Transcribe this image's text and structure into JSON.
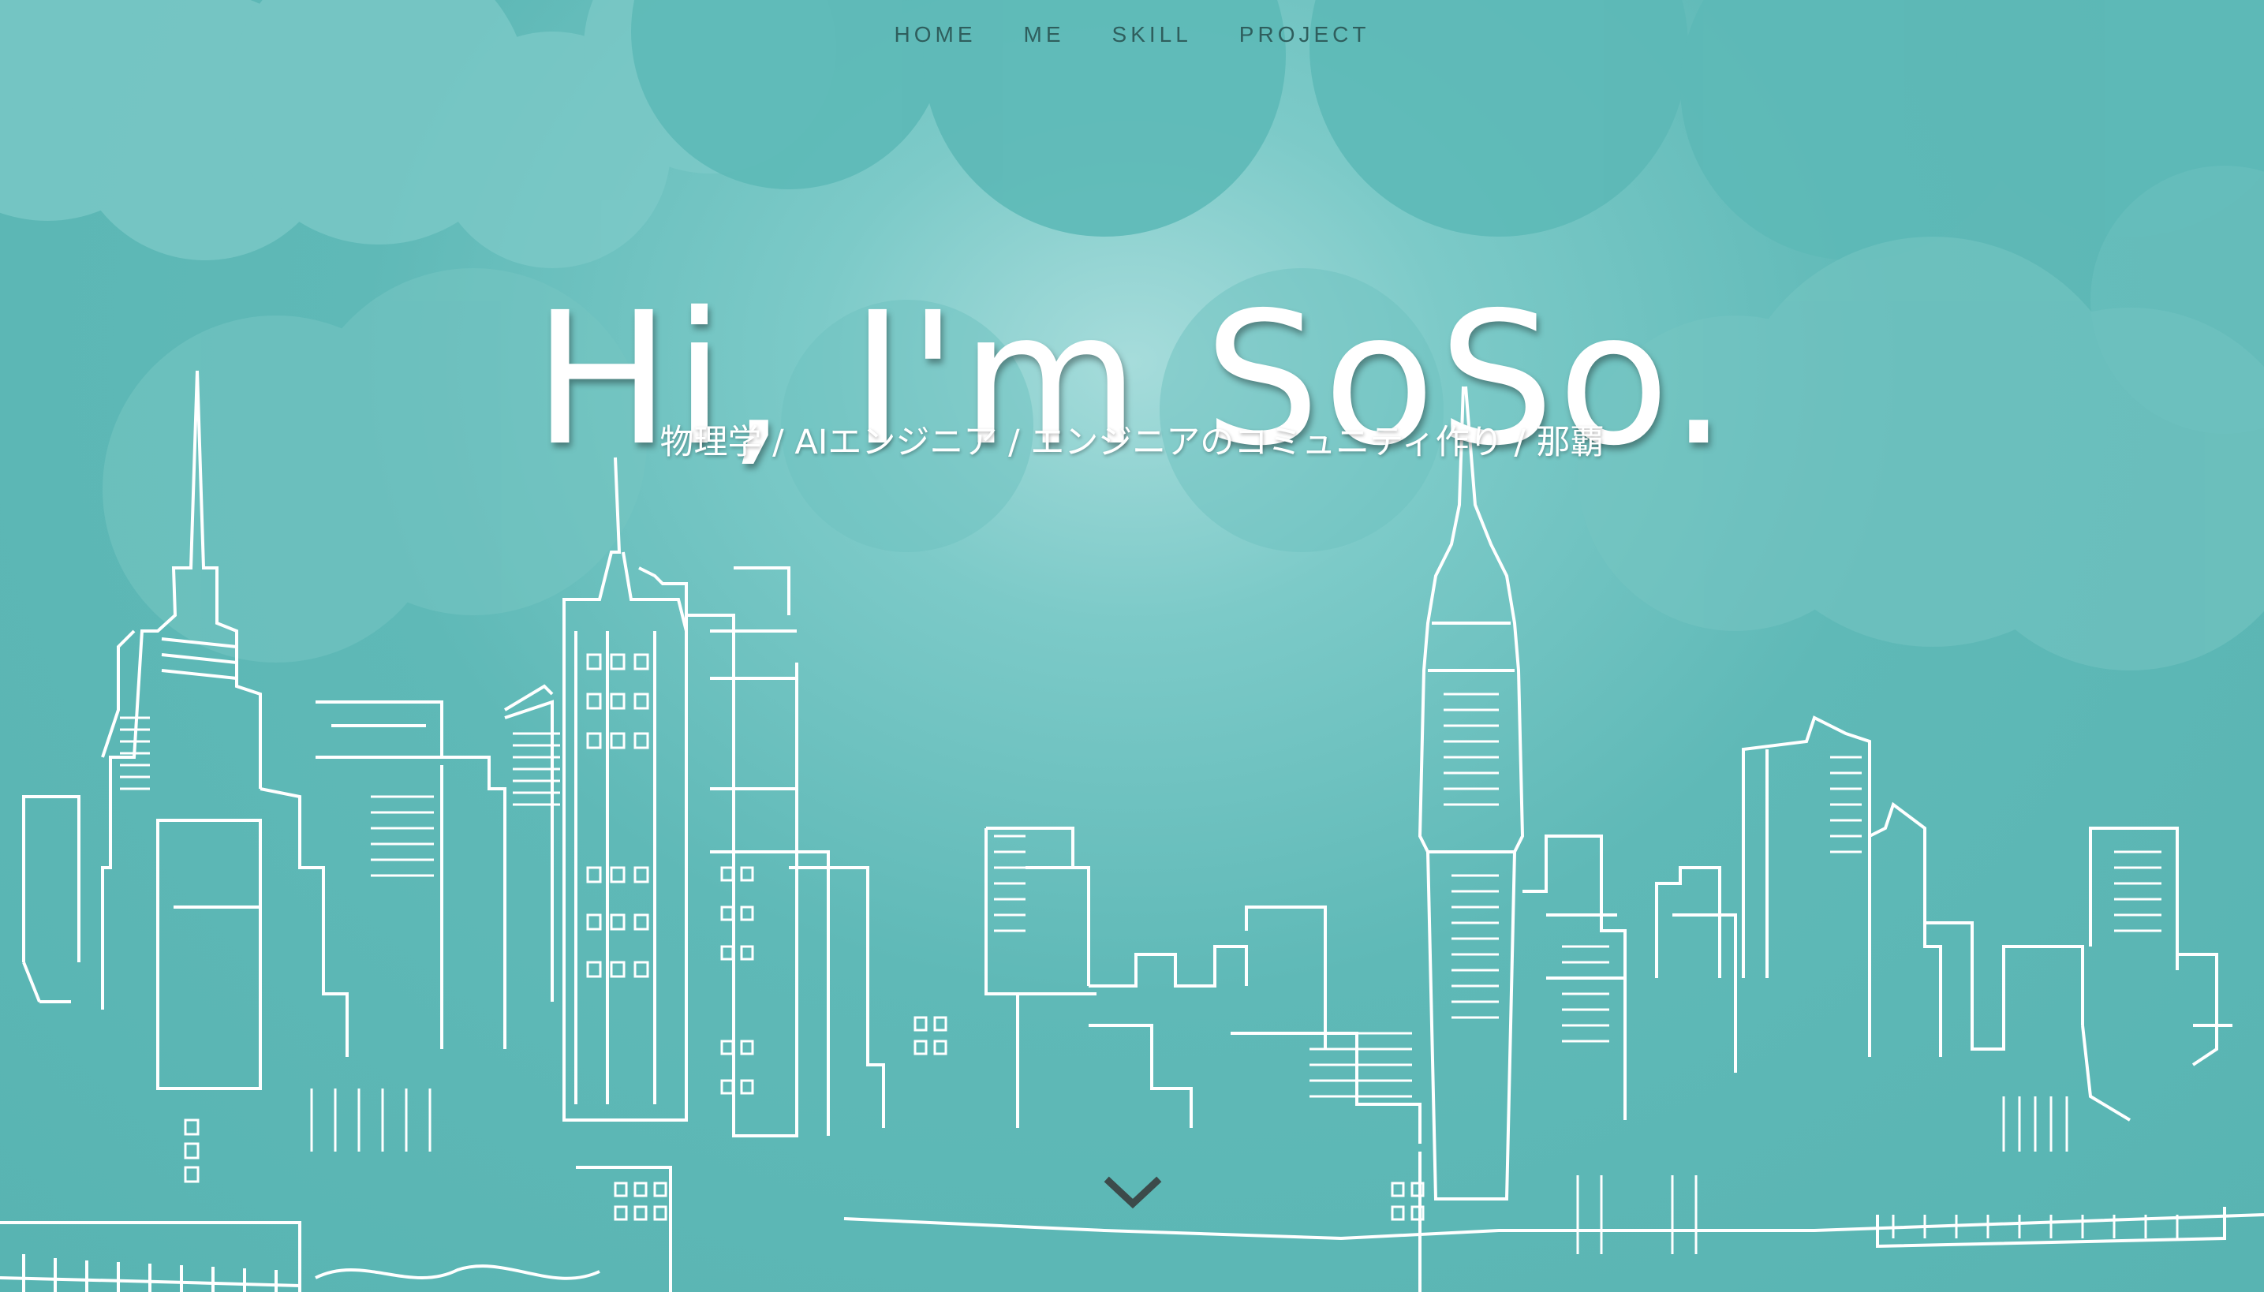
{
  "nav": {
    "items": [
      {
        "label": "HOME"
      },
      {
        "label": "ME"
      },
      {
        "label": "SKILL"
      },
      {
        "label": "PROJECT"
      }
    ]
  },
  "hero": {
    "title": "Hi, I'm SoSo.",
    "subtitle": "物理学 / AIエンジニア / エンジニアのコミュニティ作り / 那覇"
  },
  "icons": {
    "scroll": "chevron-down-icon"
  },
  "colors": {
    "background": "#5cb8b6",
    "cloud": "#7ccac8",
    "line": "#ffffff",
    "nav_text": "#2f5e5d",
    "chevron": "#3c4a4a"
  }
}
